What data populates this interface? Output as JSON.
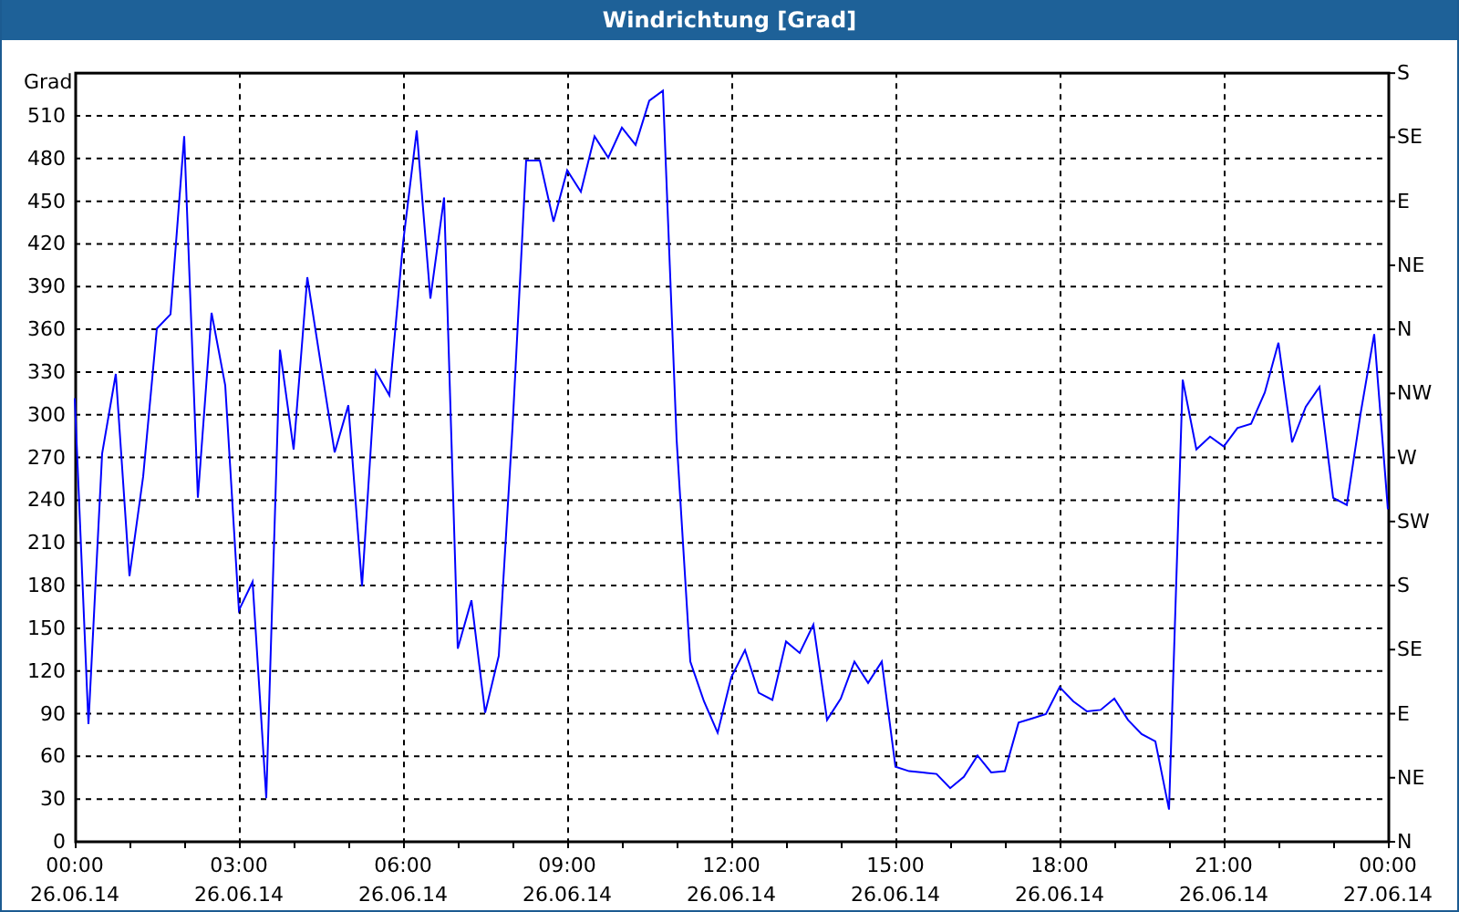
{
  "window": {
    "title": "Windrichtung [Grad]"
  },
  "chart": {
    "chart_data": {
      "type": "line",
      "grid": true,
      "ylabel": "Grad",
      "ylim": [
        0,
        540
      ],
      "yticks": [
        0,
        30,
        60,
        90,
        120,
        150,
        180,
        210,
        240,
        270,
        300,
        330,
        360,
        390,
        420,
        450,
        480,
        510
      ],
      "categories": [
        "00:00 26.06.14",
        null,
        null,
        null,
        null,
        null,
        null,
        null,
        null,
        null,
        null,
        null,
        "03:00 26.06.14",
        null,
        null,
        null,
        null,
        null,
        null,
        null,
        null,
        null,
        null,
        null,
        "06:00 26.06.14",
        null,
        null,
        null,
        null,
        null,
        null,
        null,
        null,
        null,
        null,
        null,
        "09:00 26.06.14",
        null,
        null,
        null,
        null,
        null,
        null,
        null,
        null,
        null,
        null,
        null,
        "12:00 26.06.14",
        null,
        null,
        null,
        null,
        null,
        null,
        null,
        null,
        null,
        null,
        null,
        "15:00 26.06.14",
        null,
        null,
        null,
        null,
        null,
        null,
        null,
        null,
        null,
        null,
        null,
        "18:00 26.06.14",
        null,
        null,
        null,
        null,
        null,
        null,
        null,
        null,
        null,
        null,
        null,
        "21:00 26.06.14",
        null,
        null,
        null,
        null,
        null,
        null,
        null,
        null,
        null,
        null,
        null,
        "00:00 27.06.14"
      ],
      "series": [
        {
          "color": "#0000ff",
          "values": [
            311,
            82,
            272,
            328,
            186,
            256,
            360,
            370,
            495,
            241,
            371,
            320,
            162,
            182,
            30,
            345,
            275,
            396,
            334,
            273,
            306,
            179,
            330,
            313,
            420,
            499,
            381,
            452,
            135,
            169,
            90,
            130,
            290,
            478,
            478,
            435,
            471,
            456,
            495,
            480,
            501,
            489,
            520,
            527,
            282,
            126,
            98,
            76,
            115,
            134,
            104,
            99,
            140,
            132,
            152,
            85,
            100,
            126,
            111,
            126,
            52,
            49,
            48,
            47,
            37,
            45,
            60,
            48,
            49,
            83,
            86,
            89,
            108,
            98,
            91,
            92,
            100,
            85,
            75,
            70,
            22,
            324,
            275,
            284,
            277,
            290,
            293,
            315,
            350,
            280,
            305,
            319,
            241,
            236,
            300,
            356,
            233
          ]
        }
      ]
    },
    "compass_labels": [
      "S",
      "SE",
      "E",
      "NE",
      "N",
      "NW",
      "W",
      "SW",
      "S",
      "SE",
      "E",
      "NE",
      "N"
    ]
  }
}
